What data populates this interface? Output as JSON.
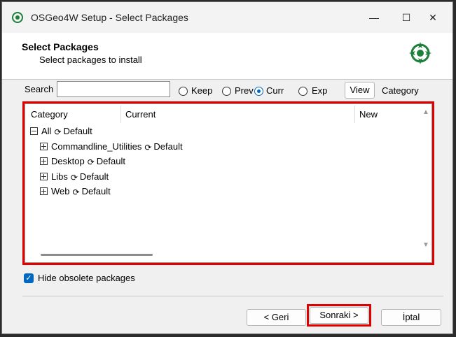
{
  "window": {
    "title": "OSGeo4W Setup - Select Packages"
  },
  "controls": {
    "minimize": "—",
    "maximize": "☐",
    "close": "✕"
  },
  "header": {
    "title": "Select Packages",
    "subtitle": "Select packages to install"
  },
  "search": {
    "label": "Search",
    "value": ""
  },
  "view_options": {
    "keep": "Keep",
    "prev": "Prev",
    "curr": "Curr",
    "exp": "Exp",
    "selected": "Curr"
  },
  "view_button": "View",
  "view_mode": "Category",
  "columns": {
    "category": "Category",
    "current": "Current",
    "new": "New"
  },
  "tree": {
    "root": {
      "name": "All",
      "action": "Default"
    },
    "children": [
      {
        "name": "Commandline_Utilities",
        "action": "Default"
      },
      {
        "name": "Desktop",
        "action": "Default"
      },
      {
        "name": "Libs",
        "action": "Default"
      },
      {
        "name": "Web",
        "action": "Default"
      }
    ]
  },
  "hide_obsolete": {
    "label": "Hide obsolete packages",
    "checked": true
  },
  "buttons": {
    "back": "< Geri",
    "next": "Sonraki >",
    "cancel": "İptal"
  },
  "colors": {
    "accent": "#0067c0",
    "highlight": "#e00000",
    "logo": "#1d7f3a"
  }
}
